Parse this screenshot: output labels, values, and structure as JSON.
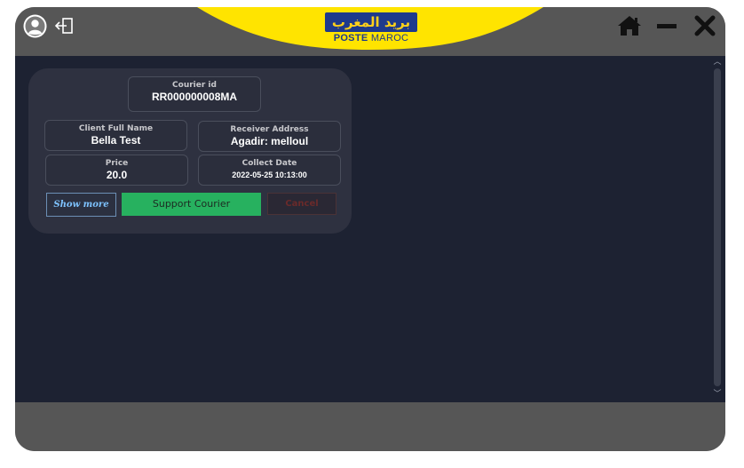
{
  "brand": {
    "arabic_name": "بريد المغرب",
    "poste_word": "POSTE",
    "maroc_word": "MAROC",
    "yellow": "#ffe400",
    "blue": "#1e3a8c"
  },
  "titlebar": {
    "avatar_icon": "user-avatar-icon",
    "logout_icon": "logout-icon",
    "home_icon": "home-icon",
    "minimize_icon": "minimize-icon",
    "close_icon": "close-icon"
  },
  "card": {
    "courier_id": {
      "label": "Courier id",
      "value": "RR000000008MA"
    },
    "client_name": {
      "label": "Client Full Name",
      "value": "Bella Test"
    },
    "receiver_address": {
      "label": "Receiver Address",
      "value": "Agadir: melloul"
    },
    "price": {
      "label": "Price",
      "value": "20.0"
    },
    "collect_date": {
      "label": "Collect Date",
      "value": "2022-05-25 10:13:00"
    },
    "buttons": {
      "show_more": "Show more",
      "support": "Support Courier",
      "cancel": "Cancel"
    }
  },
  "colors": {
    "content_bg": "#1d2232",
    "card_bg": "#2e3140",
    "support_green": "#27b15f",
    "frame_gray": "#565656"
  }
}
